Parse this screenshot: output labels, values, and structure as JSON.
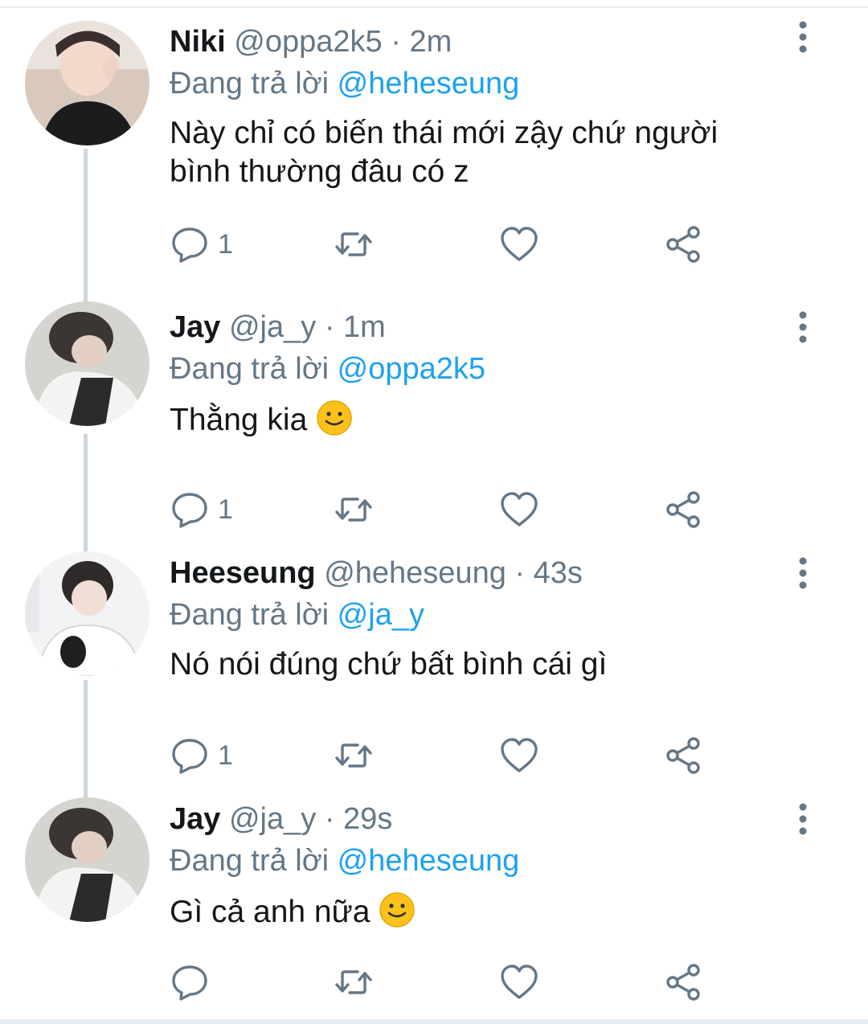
{
  "replying_prefix": "Đang trả lời",
  "colors": {
    "handle": "#657786",
    "mention": "#1da1f2",
    "text": "#14171a",
    "thread_line": "#ccd6dd"
  },
  "icons": {
    "reply": "comment-bubble-icon",
    "retweet": "retweet-icon",
    "like": "heart-icon",
    "share": "share-icon",
    "menu": "more-vertical-icon"
  },
  "tweets": [
    {
      "name": "Niki",
      "handle": "@oppa2k5",
      "separator": "·",
      "time": "2m",
      "replying_to": "@heheseung",
      "text": "Này chỉ có biến thái mới zậy chứ người bình thường đâu có z",
      "emoji": "",
      "reply_count": "1"
    },
    {
      "name": "Jay",
      "handle": "@ja_y",
      "separator": "·",
      "time": "1m",
      "replying_to": "@oppa2k5",
      "text": "Thằng kia ",
      "emoji": "slightly-smiling-face",
      "reply_count": "1"
    },
    {
      "name": "Heeseung",
      "handle": "@heheseung",
      "separator": "·",
      "time": "43s",
      "replying_to": "@ja_y",
      "text": "Nó nói đúng chứ bất bình cái gì",
      "emoji": "",
      "reply_count": "1"
    },
    {
      "name": "Jay",
      "handle": "@ja_y",
      "separator": "·",
      "time": "29s",
      "replying_to": "@heheseung",
      "text": "Gì cả anh nữa ",
      "emoji": "slightly-smiling-face",
      "reply_count": ""
    }
  ]
}
